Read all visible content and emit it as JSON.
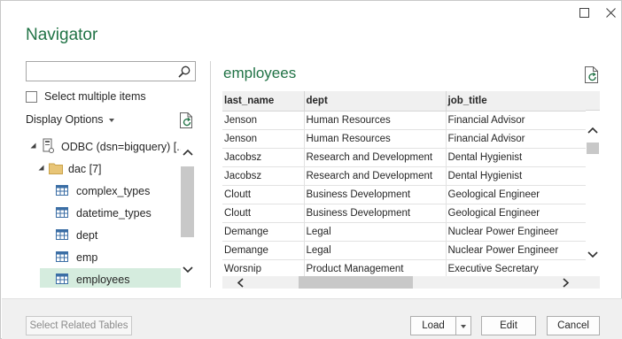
{
  "dialog": {
    "title": "Navigator"
  },
  "left_pane": {
    "search": {
      "value": "",
      "placeholder": ""
    },
    "select_multiple_label": "Select multiple items",
    "select_multiple_checked": false,
    "display_options_label": "Display Options",
    "tree": [
      {
        "label": "ODBC (dsn=bigquery) [...",
        "icon": "database-icon",
        "expanded": true,
        "level": 0
      },
      {
        "label": "dac [7]",
        "icon": "folder-icon",
        "expanded": true,
        "level": 1
      },
      {
        "label": "complex_types",
        "icon": "table-icon",
        "level": 2
      },
      {
        "label": "datetime_types",
        "icon": "table-icon",
        "level": 2
      },
      {
        "label": "dept",
        "icon": "table-icon",
        "level": 2
      },
      {
        "label": "emp",
        "icon": "table-icon",
        "level": 2
      },
      {
        "label": "employees",
        "icon": "table-icon",
        "level": 2,
        "selected": true
      }
    ]
  },
  "preview": {
    "title": "employees",
    "columns": [
      "last_name",
      "dept",
      "job_title"
    ],
    "rows": [
      [
        "Jenson",
        "Human Resources",
        "Financial Advisor"
      ],
      [
        "Jenson",
        "Human Resources",
        "Financial Advisor"
      ],
      [
        "Jacobsz",
        "Research and Development",
        "Dental Hygienist"
      ],
      [
        "Jacobsz",
        "Research and Development",
        "Dental Hygienist"
      ],
      [
        "Cloutt",
        "Business Development",
        "Geological Engineer"
      ],
      [
        "Cloutt",
        "Business Development",
        "Geological Engineer"
      ],
      [
        "Demange",
        "Legal",
        "Nuclear Power Engineer"
      ],
      [
        "Demange",
        "Legal",
        "Nuclear Power Engineer"
      ],
      [
        "Worsnip",
        "Product Management",
        "Executive Secretary"
      ]
    ]
  },
  "footer": {
    "select_related_label": "Select Related Tables",
    "load_label": "Load",
    "edit_label": "Edit",
    "cancel_label": "Cancel"
  },
  "colors": {
    "accent": "#217346",
    "selection": "#d5ecde"
  }
}
